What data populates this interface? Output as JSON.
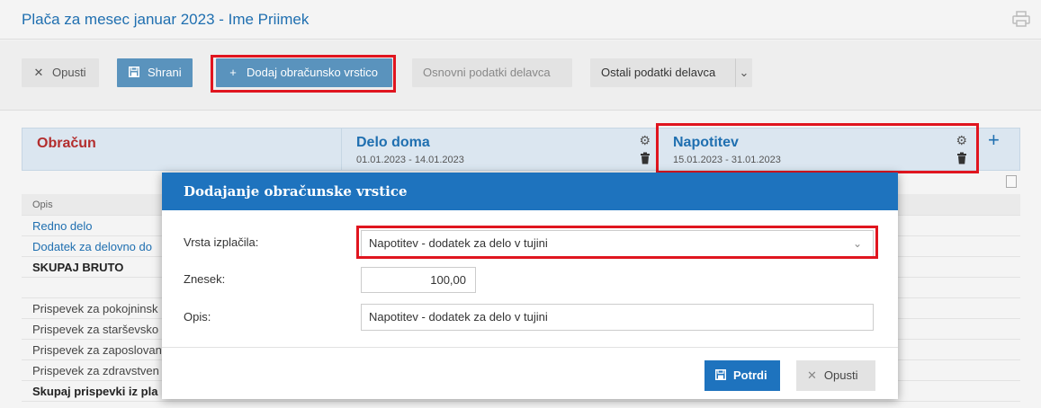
{
  "window": {
    "title": "Plača za mesec januar 2023 - Ime Priimek",
    "print_icon": "printer-icon"
  },
  "toolbar": {
    "opusti_label": "Opusti",
    "shrani_label": "Shrani",
    "dodaj_label": "Dodaj obračunsko vrstico",
    "osnovni_label": "Osnovni podatki delavca",
    "ostali_label": "Ostali podatki delavca",
    "accent": "#5a93bd"
  },
  "grid": {
    "obracun_label": "Obračun",
    "columns": [
      {
        "title": "Delo doma",
        "dates": "01.01.2023 - 14.01.2023"
      },
      {
        "title": "Napotitev",
        "dates": "15.01.2023 - 31.01.2023"
      }
    ],
    "add_column": "+"
  },
  "table": {
    "header": "Opis",
    "rows": [
      "Redno delo",
      "Dodatek za delovno do",
      "SKUPAJ BRUTO",
      "",
      "Prispevek za pokojninsk",
      "Prispevek za starševsko",
      "Prispevek za zaposlovan",
      "Prispevek za zdravstven",
      "Skupaj prispevki iz pla"
    ]
  },
  "dialog": {
    "title": "Dodajanje obračunske vrstice",
    "vrsta_label": "Vrsta izplačila:",
    "vrsta_value": "Napotitev - dodatek za delo v tujini",
    "znesek_label": "Znesek:",
    "znesek_value": "100,00",
    "opis_label": "Opis:",
    "opis_value": "Napotitev - dodatek za delo v tujini",
    "potrdi_label": "Potrdi",
    "opusti_label": "Opusti",
    "header_color": "#1e73be"
  },
  "highlight_color": "#e0151f"
}
